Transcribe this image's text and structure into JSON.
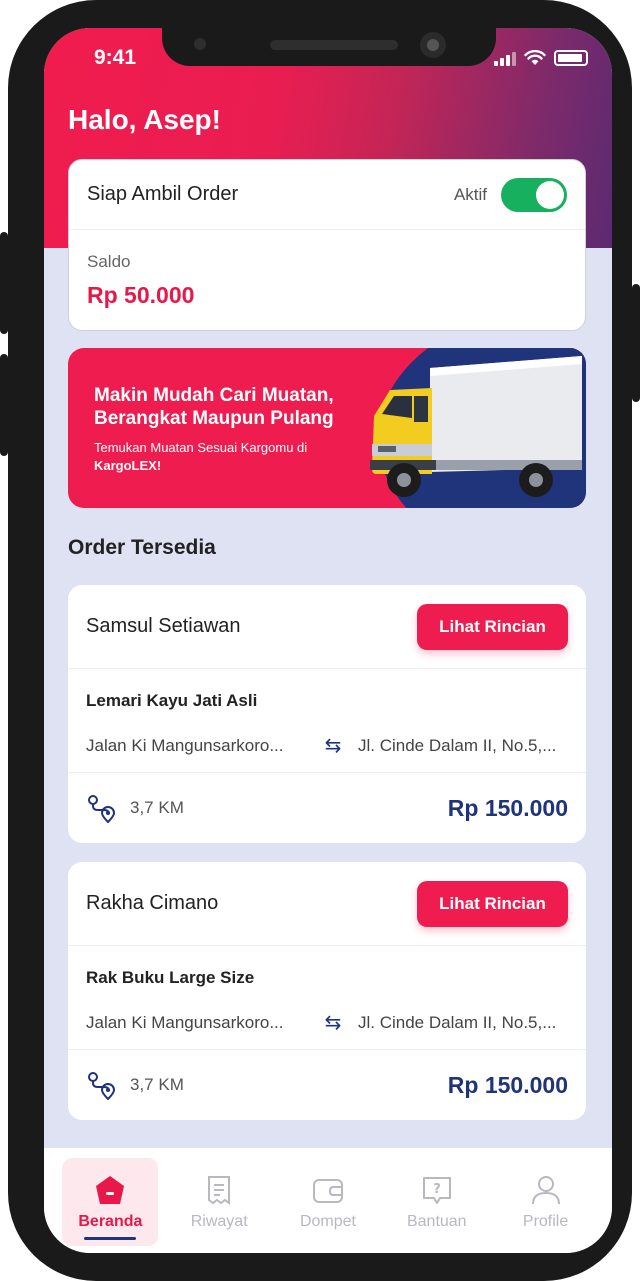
{
  "status_bar": {
    "time": "9:41"
  },
  "greeting": "Halo, Asep!",
  "status_card": {
    "title": "Siap Ambil Order",
    "toggle_label": "Aktif",
    "toggle_on": true,
    "saldo_label": "Saldo",
    "saldo_value": "Rp 50.000"
  },
  "banner": {
    "headline": "Makin Mudah Cari Muatan, Berangkat Maupun Pulang",
    "sub_text": "Temukan Muatan Sesuai Kargomu di",
    "brand": "KargoLEX!"
  },
  "section_title": "Order Tersedia",
  "orders": [
    {
      "name": "Samsul Setiawan",
      "button": "Lihat Rincian",
      "item": "Lemari Kayu Jati Asli",
      "from": "Jalan Ki Mangunsarkoro...",
      "to": "Jl. Cinde Dalam II, No.5,...",
      "distance": "3,7 KM",
      "price": "Rp 150.000"
    },
    {
      "name": "Rakha Cimano",
      "button": "Lihat Rincian",
      "item": "Rak Buku Large Size",
      "from": "Jalan Ki Mangunsarkoro...",
      "to": "Jl. Cinde Dalam II, No.5,...",
      "distance": "3,7 KM",
      "price": "Rp 150.000"
    }
  ],
  "tabbar": {
    "items": [
      {
        "label": "Beranda",
        "icon": "home-icon",
        "active": true
      },
      {
        "label": "Riwayat",
        "icon": "receipt-icon",
        "active": false
      },
      {
        "label": "Dompet",
        "icon": "wallet-icon",
        "active": false
      },
      {
        "label": "Bantuan",
        "icon": "help-icon",
        "active": false
      },
      {
        "label": "Profile",
        "icon": "user-icon",
        "active": false
      }
    ]
  },
  "colors": {
    "accent": "#ef1d4f",
    "navy": "#1f347a",
    "toggle_on": "#16b05f",
    "background": "#dfe2f3"
  }
}
